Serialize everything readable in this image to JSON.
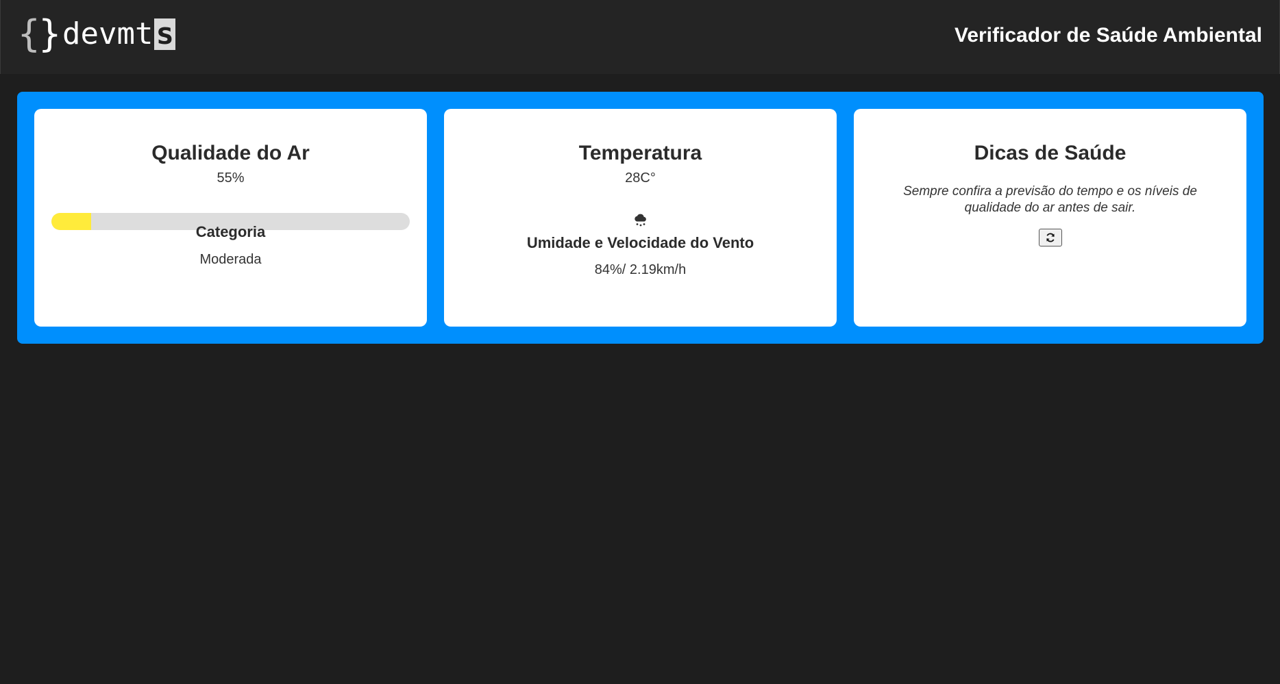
{
  "header": {
    "logo_braces_open": "{",
    "logo_braces_close": "}",
    "logo_text": "devmt",
    "logo_last_letter": "s",
    "title": "Verificador de Saúde Ambiental"
  },
  "air_quality": {
    "title": "Qualidade do Ar",
    "percent_label": "55%",
    "progress_fraction": 0.11,
    "progress_color": "#ffeb3b",
    "category_title": "Categoria",
    "category_value": "Moderada"
  },
  "temperature": {
    "title": "Temperatura",
    "value": "28C°",
    "weather_icon": "cloud-rain-icon",
    "humidity_title": "Umidade e Velocidade do Vento",
    "humidity_value": "84%/ 2.19km/h"
  },
  "health_tips": {
    "title": "Dicas de Saúde",
    "tip": "Sempre confira a previsão do tempo e os níveis de qualidade do ar antes de sair.",
    "refresh_icon": "refresh-icon"
  },
  "colors": {
    "background": "#1e1e1e",
    "header": "#242424",
    "panel": "#008ffd",
    "card": "#ffffff"
  }
}
